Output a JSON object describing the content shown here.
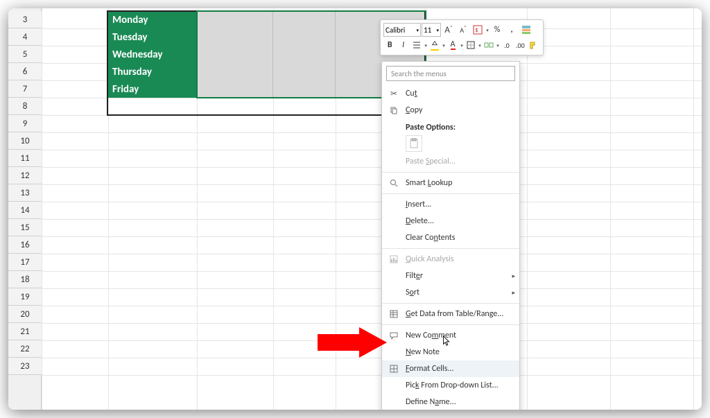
{
  "days": [
    "Monday",
    "Tuesday",
    "Wednesday",
    "Thursday",
    "Friday"
  ],
  "rowNumbers": [
    3,
    4,
    5,
    6,
    7,
    8,
    9,
    10,
    11,
    12,
    13,
    14,
    15,
    16,
    17,
    18,
    19,
    20,
    21,
    22,
    23
  ],
  "miniToolbar": {
    "font": "Calibri",
    "size": "11",
    "incFont": "A˄",
    "decFont": "A˅",
    "bold": "B",
    "italic": "I",
    "percent": "%",
    "comma": ",",
    "fontColor": "A"
  },
  "contextMenu": {
    "searchPlaceholder": "Search the menus",
    "cut": "Cut",
    "copy": "Copy",
    "pasteOptions": "Paste Options:",
    "pasteSpecial": "Paste Special...",
    "smartLookup": "Smart Lookup",
    "insert": "Insert...",
    "delete": "Delete...",
    "clearContents": "Clear Contents",
    "quickAnalysis": "Quick Analysis",
    "filter": "Filter",
    "sort": "Sort",
    "getData": "Get Data from Table/Range...",
    "newComment": "New Comment",
    "newNote": "New Note",
    "formatCells": "Format Cells...",
    "pickFromList": "Pick From Drop-down List...",
    "defineName": "Define Name..."
  }
}
